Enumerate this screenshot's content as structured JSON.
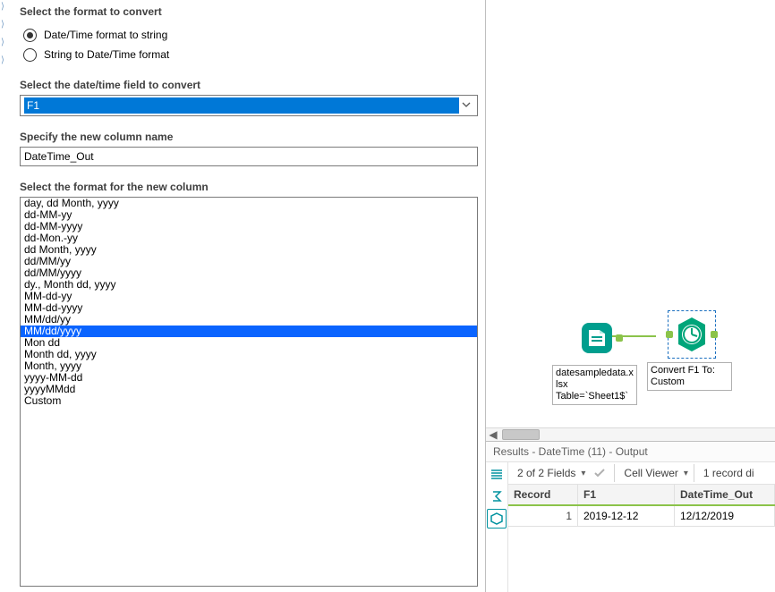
{
  "config": {
    "section_format_label": "Select the format to convert",
    "radio_dt_to_string": "Date/Time format to string",
    "radio_string_to_dt": "String to Date/Time format",
    "radio_checked": "dt_to_string",
    "section_field_label": "Select the date/time field to convert",
    "field_value": "F1",
    "section_newcol_label": "Specify the new column name",
    "newcol_value": "DateTime_Out",
    "section_format_list_label": "Select the format for the new column",
    "formats": [
      "day, dd Month, yyyy",
      "dd-MM-yy",
      "dd-MM-yyyy",
      "dd-Mon.-yy",
      "dd Month, yyyy",
      "dd/MM/yy",
      "dd/MM/yyyy",
      "dy., Month dd, yyyy",
      "MM-dd-yy",
      "MM-dd-yyyy",
      "MM/dd/yy",
      "MM/dd/yyyy",
      "Mon dd",
      "Month dd, yyyy",
      "Month, yyyy",
      "yyyy-MM-dd",
      "yyyyMMdd",
      "Custom"
    ],
    "format_selected_index": 11
  },
  "canvas": {
    "node_input_caption": "datesampledata.xlsx\nTable=`Sheet1$`",
    "node_datetime_caption": "Convert F1 To: Custom"
  },
  "results": {
    "title": "Results - DateTime (11) - Output",
    "fields_text": "2 of 2 Fields",
    "cell_viewer_text": "Cell Viewer",
    "record_count_text": "1 record di",
    "columns": [
      "Record",
      "F1",
      "DateTime_Out"
    ],
    "rows": [
      {
        "record": "1",
        "F1": "2019-12-12",
        "DateTime_Out": "12/12/2019"
      }
    ]
  }
}
